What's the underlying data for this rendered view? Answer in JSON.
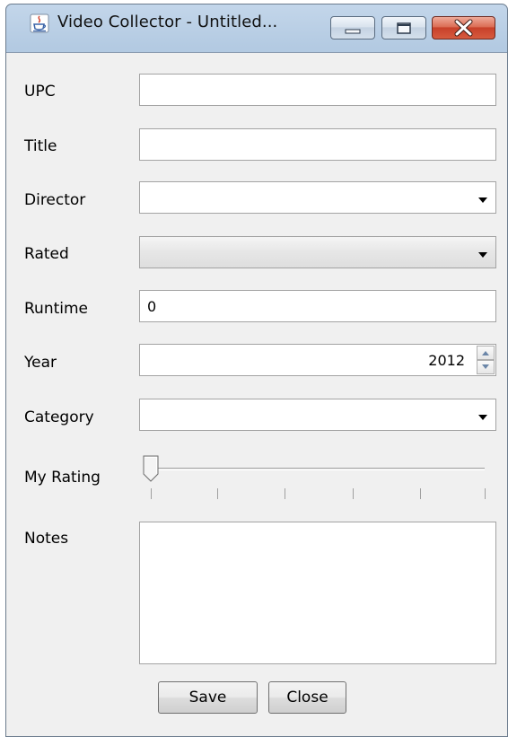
{
  "window": {
    "title": "Video Collector - Untitled...",
    "controls": [
      "minimize",
      "maximize",
      "close"
    ]
  },
  "form": {
    "upc": {
      "label": "UPC",
      "value": ""
    },
    "title": {
      "label": "Title",
      "value": ""
    },
    "director": {
      "label": "Director",
      "value": ""
    },
    "rated": {
      "label": "Rated",
      "value": ""
    },
    "runtime": {
      "label": "Runtime",
      "value": "0"
    },
    "year": {
      "label": "Year",
      "value": "2012"
    },
    "category": {
      "label": "Category",
      "value": ""
    },
    "my_rating": {
      "label": "My Rating",
      "value": 0,
      "max": 5
    },
    "notes": {
      "label": "Notes",
      "value": ""
    }
  },
  "buttons": {
    "save": "Save",
    "close": "Close"
  },
  "icons": {
    "app": "java-cup-icon",
    "combo_arrow": "caret-down-icon",
    "spinner": "spinner-arrows-icon"
  },
  "colors": {
    "title_bar": "#b3cae2",
    "close_button": "#c8412a",
    "panel": "#f0f0f0",
    "field_border": "#a3a3a3"
  }
}
